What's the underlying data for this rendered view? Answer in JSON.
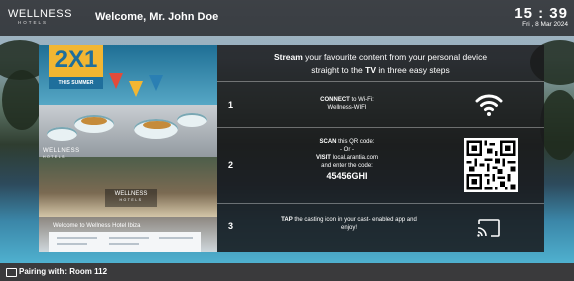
{
  "header": {
    "logo_text": "WELLNESS",
    "logo_subtext": "HOTELS",
    "welcome_text": "Welcome, Mr. John Doe",
    "time": "15 : 39",
    "date": "Fri , 8 Mar 2024"
  },
  "promo": {
    "badge_big": "2X1",
    "badge_small": "THIS SUMMER",
    "brand_overlay": "WELLNESS",
    "brand_overlay_sub": "HOTELS",
    "brand_box": "WELLNESS",
    "brand_box_sub": "HOTELS",
    "caption": "Welcome to Wellness Hotel Ibiza"
  },
  "panel": {
    "headline_bold_1": "Stream",
    "headline_rest_1": " your favourite content from your personal device",
    "headline_rest_2a": "straight to the ",
    "headline_bold_2": "TV",
    "headline_rest_2b": " in three easy steps",
    "steps": [
      {
        "number": "1",
        "bold": "CONNECT",
        "text": " to Wi-Fi:",
        "line2": "Wellness-WIFI",
        "icon": "wifi-icon"
      },
      {
        "number": "2",
        "bold": "SCAN",
        "text": " this QR code:",
        "line2": "- Or -",
        "bold2": "VISIT",
        "line3": " local.arantia.com",
        "line4": "and enter the code:",
        "code": "45456GHI",
        "icon": "qr-code-icon"
      },
      {
        "number": "3",
        "bold": "TAP",
        "text": " the casting icon in your cast- enabled app and",
        "line2": "enjoy!",
        "icon": "cast-icon"
      }
    ]
  },
  "footer": {
    "pairing_text": "Pairing with: Room 112",
    "icon": "cast-icon"
  }
}
